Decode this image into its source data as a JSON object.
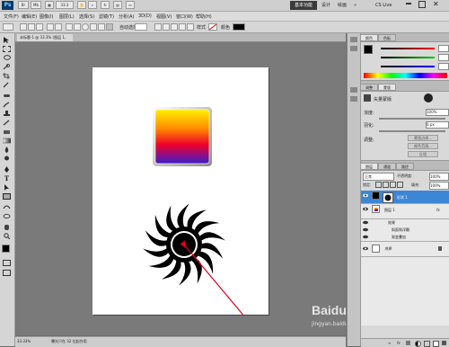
{
  "app": {
    "logo": "Ps",
    "zoom_small": "33.3",
    "workspace_active": "基本功能",
    "workspace_tabs": [
      "设计",
      "绘画"
    ],
    "more_label": "»",
    "cslive": "CS Live"
  },
  "menu": [
    "文件(F)",
    "编辑(E)",
    "图像(I)",
    "图层(L)",
    "选择(S)",
    "滤镜(T)",
    "分析(A)",
    "3D(D)",
    "视图(V)",
    "窗口(W)",
    "帮助(H)"
  ],
  "options": {
    "auto_select_label": "自动选择",
    "show_transform_label": "显示变换控件",
    "mode_label": "样式",
    "color_label": "颜色"
  },
  "document": {
    "tab_title": "未标题-1 @ 33.3% (图层 1, RGB/8) *",
    "status_zoom": "33.33%",
    "status_text": "曝光只在 32 位起作用"
  },
  "panels": {
    "color_tab": "颜色",
    "swatches_tab": "色板",
    "adjust_tab": "调整",
    "styles_tab": "样式",
    "masks_tab": "蒙版",
    "masks_title": "矢量蒙版",
    "density_label": "浓度:",
    "density_value": "100%",
    "feather_label": "羽化:",
    "feather_value": "0 px",
    "refine_label": "调整:",
    "btn_mask_edge": "蒙版边缘...",
    "btn_color_range": "颜色范围...",
    "btn_invert": "反相"
  },
  "layers": {
    "tab_layers": "图层",
    "tab_channels": "通道",
    "tab_paths": "路径",
    "blend_mode": "正常",
    "opacity_label": "不透明度:",
    "opacity_value": "100%",
    "lock_label": "锁定:",
    "fill_label": "填充:",
    "fill_value": "100%",
    "rows": [
      {
        "name": "形状 1",
        "selected": true
      },
      {
        "name": "图层 1",
        "selected": false
      },
      {
        "name": "效果",
        "selected": false
      },
      {
        "name": "斜面和浮雕",
        "selected": false
      },
      {
        "name": "渐变叠加",
        "selected": false
      },
      {
        "name": "背景",
        "selected": false
      }
    ]
  },
  "watermark": {
    "brand": "Baidu",
    "sub": "经验",
    "url": "jingyan.baidu.com"
  }
}
